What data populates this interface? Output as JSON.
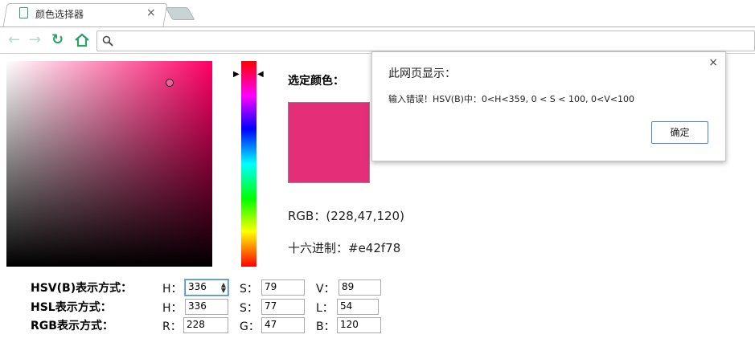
{
  "browser": {
    "tab_title": "颜色选择器",
    "tab_close": "×",
    "icons": {
      "page": "page-icon",
      "back": "back-arrow-icon",
      "forward": "forward-arrow-icon",
      "reload": "reload-icon",
      "home": "home-icon",
      "search": "search-icon"
    },
    "accent": "#2e9e6b"
  },
  "picker": {
    "selected_label": "选定颜色：",
    "swatch_color": "#e42f78",
    "rgb_text": "RGB：(228,47,120)",
    "hex_text": "十六进制：#e42f78"
  },
  "rows": {
    "hsv": {
      "label": "HSV(B)表示方式：",
      "c1": "H：",
      "v1": "336",
      "c2": "S：",
      "v2": "79",
      "c3": "V：",
      "v3": "89"
    },
    "hsl": {
      "label": "HSL表示方式：",
      "c1": "H：",
      "v1": "336",
      "c2": "S：",
      "v2": "77",
      "c3": "L：",
      "v3": "54"
    },
    "rgb": {
      "label": "RGB表示方式：",
      "c1": "R：",
      "v1": "228",
      "c2": "G：",
      "v2": "47",
      "c3": "B：",
      "v3": "120"
    }
  },
  "dialog": {
    "title": "此网页显示：",
    "close": "×",
    "message": "输入错误！HSV(B)中：0<H<359, 0 < S < 100,  0<V<100",
    "ok": "确定"
  }
}
